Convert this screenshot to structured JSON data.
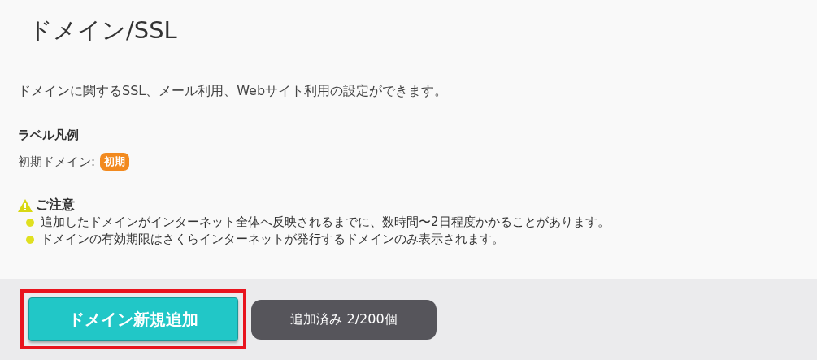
{
  "title": "ドメイン/SSL",
  "description": "ドメインに関するSSL、メール利用、Webサイト利用の設定ができます。",
  "legend": {
    "heading": "ラベル凡例",
    "items": [
      {
        "label": "初期ドメイン:",
        "badge": "初期"
      }
    ]
  },
  "notice": {
    "heading": "ご注意",
    "items": [
      "追加したドメインがインターネット全体へ反映されるまでに、数時間〜2日程度かかることがあります。",
      "ドメインの有効期限はさくらインターネットが発行するドメインのみ表示されます。"
    ]
  },
  "actions": {
    "add_button": {
      "label": "ドメイン新規追加",
      "highlighted": true
    },
    "count": "追加済み 2/200個"
  }
}
